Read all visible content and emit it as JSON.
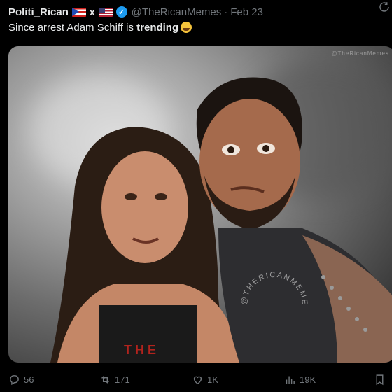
{
  "post": {
    "author_name": "Politi_Rican",
    "x_mark": "x",
    "handle": "@TheRicanMemes",
    "separator": "·",
    "date": "Feb 23",
    "text_prefix": "Since arrest Adam Schiff is ",
    "text_bold": "trending",
    "watermark": "@TheRicanMemes",
    "image_text": "@THERICANMEMES"
  },
  "stats": {
    "replies": "56",
    "reposts": "171",
    "likes": "1K",
    "views": "19K"
  },
  "colors": {
    "background": "#000000",
    "text": "#e7e9ea",
    "muted": "#71767b",
    "verified": "#1d9bf0"
  },
  "icons": [
    "verified-badge-icon",
    "refresh-icon",
    "reply-icon",
    "repost-icon",
    "like-icon",
    "views-icon",
    "bookmark-icon"
  ]
}
